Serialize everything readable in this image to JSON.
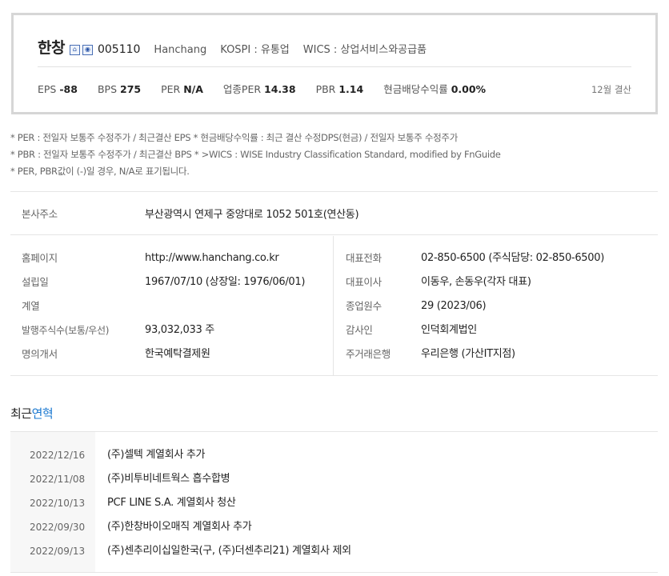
{
  "summary": {
    "name": "한창",
    "icons": [
      "home-icon",
      "info-icon"
    ],
    "code": "005110",
    "eng_name": "Hanchang",
    "market": "KOSPI : 유통업",
    "wics": "WICS : 상업서비스와공급품",
    "metrics": [
      {
        "label": "EPS",
        "value": "-88"
      },
      {
        "label": "BPS",
        "value": "275"
      },
      {
        "label": "PER",
        "value": "N/A"
      },
      {
        "label": "업종PER",
        "value": "14.38"
      },
      {
        "label": "PBR",
        "value": "1.14"
      },
      {
        "label": "현금배당수익률",
        "value": "0.00%"
      }
    ],
    "settlement": "12월 결산"
  },
  "notes": [
    "* PER : 전일자 보통주 수정주가 / 최근결산 EPS * 현금배당수익률 : 최근 결산 수정DPS(현금) / 전일자 보통주 수정주가",
    "* PBR : 전일자 보통주 수정주가 / 최근결산 BPS * >WICS : WISE Industry Classification Standard, modified by FnGuide",
    "* PER, PBR값이 (-)일 경우, N/A로 표기됩니다."
  ],
  "info": {
    "address": {
      "label": "본사주소",
      "value": "부산광역시 연제구 중앙대로 1052 501호(연산동)"
    },
    "left": [
      {
        "label": "홈페이지",
        "value": "http://www.hanchang.co.kr"
      },
      {
        "label": "설립일",
        "value": "1967/07/10 (상장일: 1976/06/01)"
      },
      {
        "label": "계열",
        "value": ""
      },
      {
        "label": "발행주식수(보통/우선)",
        "value": "93,032,033 주"
      },
      {
        "label": "명의개서",
        "value": "한국예탁결제원"
      }
    ],
    "right": [
      {
        "label": "대표전화",
        "value": "02-850-6500 (주식담당: 02-850-6500)"
      },
      {
        "label": "대표이사",
        "value": "이동우, 손동우(각자 대표)"
      },
      {
        "label": "종업원수",
        "value": "29 (2023/06)"
      },
      {
        "label": "감사인",
        "value": "인덕회계법인"
      },
      {
        "label": "주거래은행",
        "value": "우리은행 (가산IT지점)"
      }
    ]
  },
  "history": {
    "title_prefix": "최근",
    "title_accent": "연혁",
    "items": [
      {
        "date": "2022/12/16",
        "text": "(주)셀텍 계열회사 추가"
      },
      {
        "date": "2022/11/08",
        "text": "(주)비투비네트웍스 흡수합병"
      },
      {
        "date": "2022/10/13",
        "text": "PCF LINE S.A. 계열회사 청산"
      },
      {
        "date": "2022/09/30",
        "text": "(주)한창바이오매직 계열회사 추가"
      },
      {
        "date": "2022/09/13",
        "text": "(주)센추리이십일한국(구, (주)더센추리21) 계열회사 제외"
      }
    ]
  }
}
